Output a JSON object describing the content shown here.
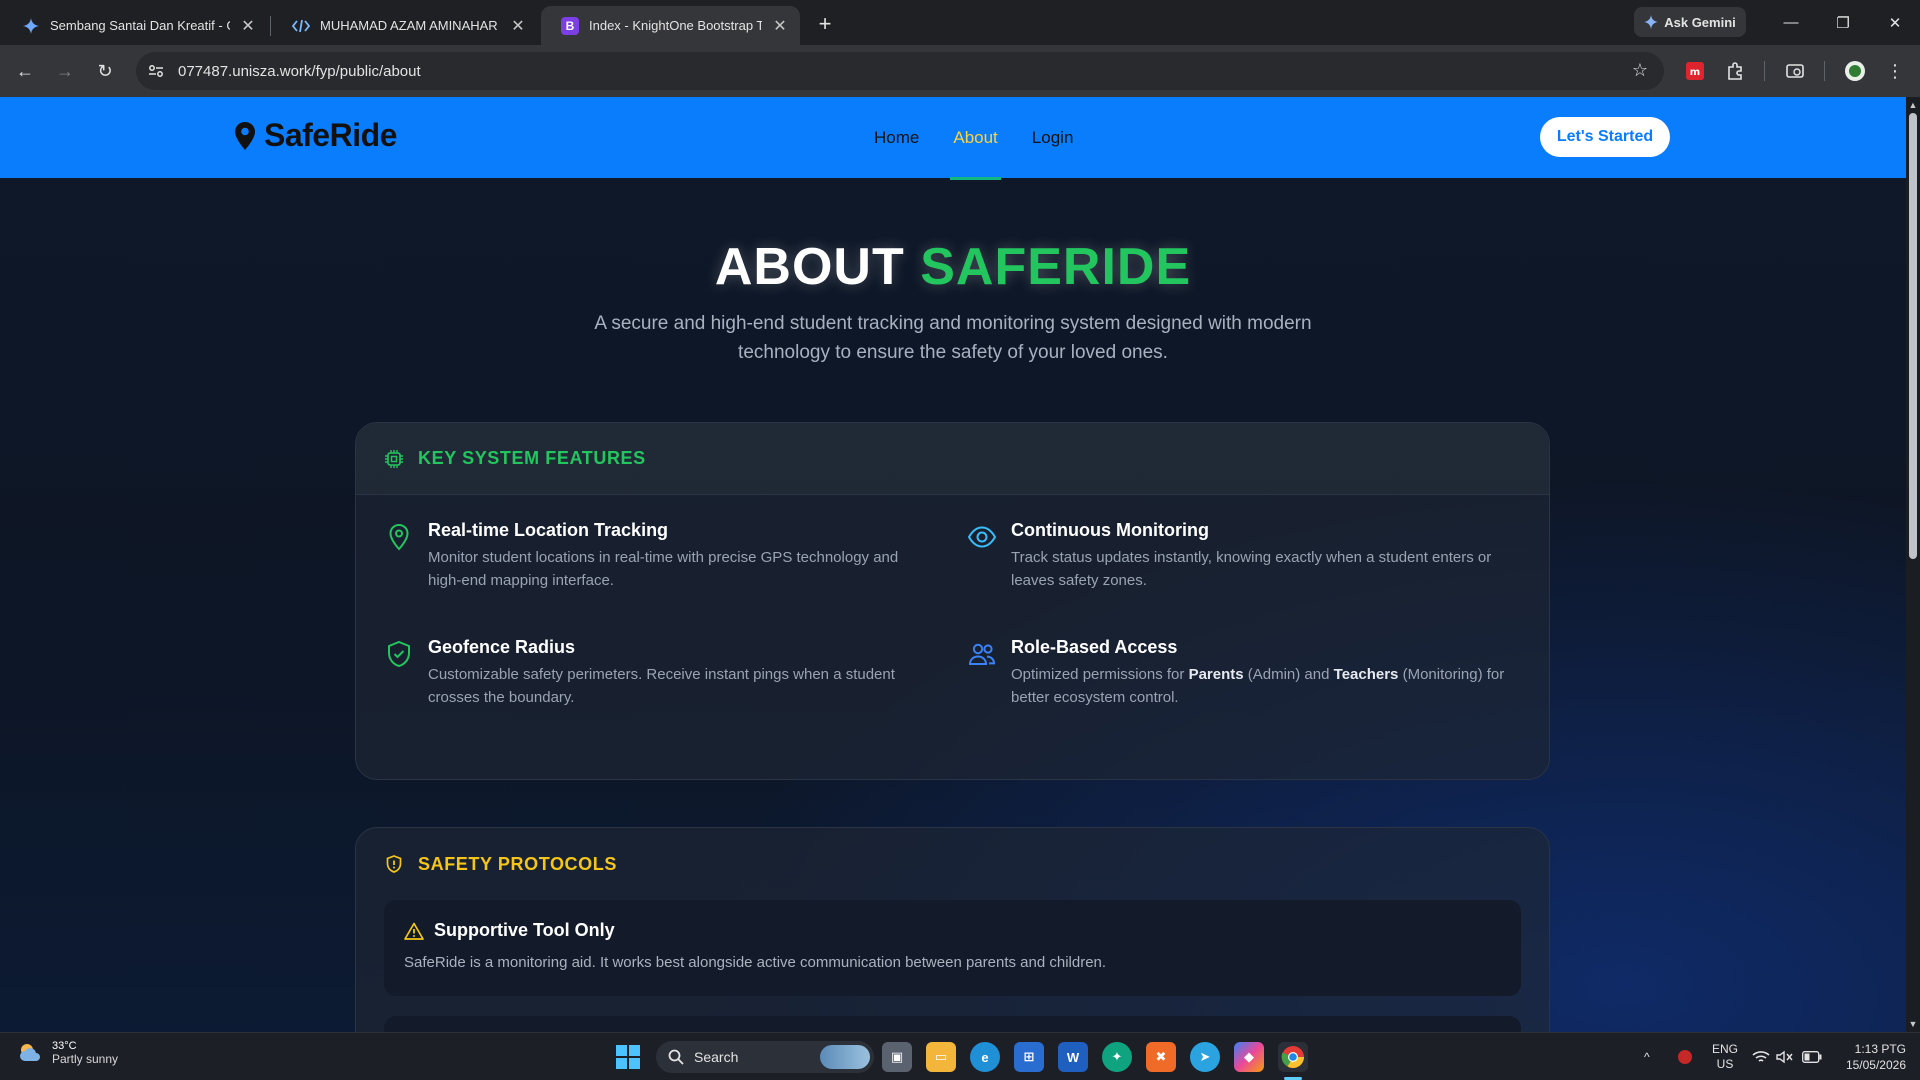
{
  "browser": {
    "tabs": [
      {
        "title": "Sembang Santai Dan Kreatif - Goo",
        "active": false
      },
      {
        "title": "MUHAMAD AZAM AMINAHAR | e",
        "active": false
      },
      {
        "title": "Index - KnightOne Bootstrap Temp",
        "active": true
      }
    ],
    "gemini_label": "Ask Gemini",
    "url": "077487.unisza.work/fyp/public/about"
  },
  "site": {
    "brand": "SafeRide",
    "nav": [
      {
        "label": "Home",
        "active": false
      },
      {
        "label": "About",
        "active": true
      },
      {
        "label": "Login",
        "active": false
      }
    ],
    "cta": "Let's Started"
  },
  "hero": {
    "title_main": "ABOUT ",
    "title_accent": "SAFERIDE",
    "subtitle": "A secure and high-end student tracking and monitoring system designed with modern technology to ensure the safety of your loved ones."
  },
  "features": {
    "heading": "KEY SYSTEM FEATURES",
    "items": [
      {
        "title": "Real-time Location Tracking",
        "desc": "Monitor student locations in real-time with precise GPS technology and high-end mapping interface.",
        "icon": "map-pin-icon"
      },
      {
        "title": "Continuous Monitoring",
        "desc": "Track status updates instantly, knowing exactly when a student enters or leaves safety zones.",
        "icon": "eye-icon"
      },
      {
        "title": "Geofence Radius",
        "desc": "Customizable safety perimeters. Receive instant pings when a student crosses the boundary.",
        "icon": "shield-check-icon"
      },
      {
        "title": "Role-Based Access",
        "desc_pre": "Optimized permissions for ",
        "desc_b1": "Parents",
        "desc_mid": " (Admin) and ",
        "desc_b2": "Teachers",
        "desc_post": " (Monitoring) for better ecosystem control.",
        "icon": "users-icon"
      }
    ]
  },
  "safety": {
    "heading": "SAFETY PROTOCOLS",
    "items": [
      {
        "title": "Supportive Tool Only",
        "desc": "SafeRide is a monitoring aid. It works best alongside active communication between parents and children."
      }
    ]
  },
  "taskbar": {
    "temp": "33°C",
    "weather": "Partly sunny",
    "search": "Search",
    "lang1": "ENG",
    "lang2": "US",
    "time": "1:13 PTG",
    "date": "15/05/2026"
  },
  "colors": {
    "header_blue": "#0a7dfc",
    "accent_green": "#22c55e",
    "accent_yellow": "#f5c518",
    "nav_active": "#ffd23a"
  }
}
